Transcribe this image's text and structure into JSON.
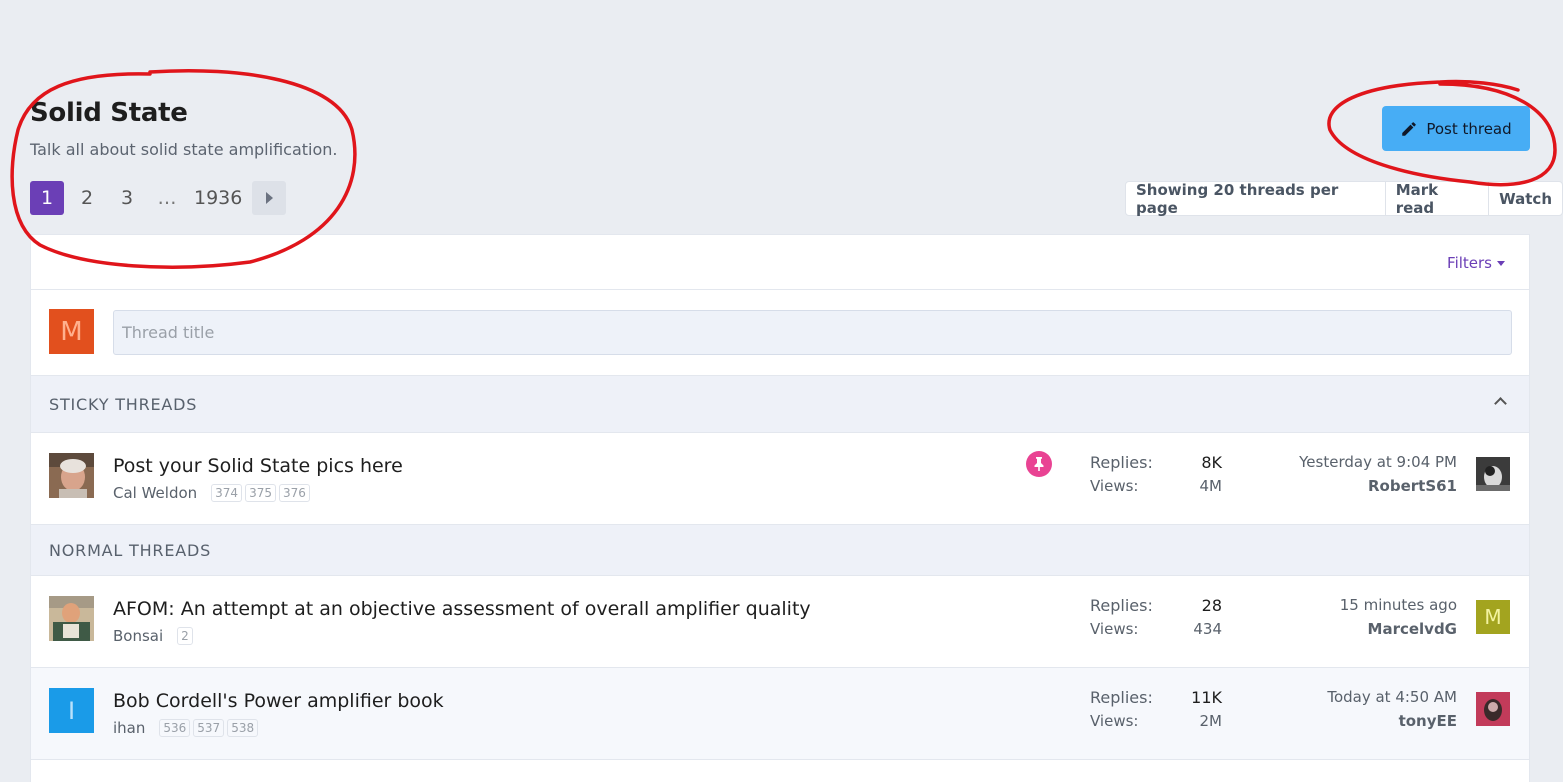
{
  "forum": {
    "title": "Solid State",
    "description": "Talk all about solid state amplification."
  },
  "pagination": {
    "pages": [
      "1",
      "2",
      "3",
      "…",
      "1936"
    ],
    "current": "1"
  },
  "post_button": {
    "label": "Post thread",
    "icon": "pencil-icon"
  },
  "actions": [
    "Showing 20 threads per page",
    "Mark read",
    "Watch"
  ],
  "filters_label": "Filters",
  "quick_thread": {
    "avatar_letter": "M",
    "placeholder": "Thread title"
  },
  "sections": {
    "sticky": "STICKY THREADS",
    "normal": "NORMAL THREADS"
  },
  "sticky_threads": [
    {
      "title": "Post your Solid State pics here",
      "author": "Cal Weldon",
      "pages": [
        "374",
        "375",
        "376"
      ],
      "replies_label": "Replies:",
      "replies": "8K",
      "views_label": "Views:",
      "views": "4M",
      "last_time": "Yesterday at 9:04 PM",
      "last_user": "RobertS61",
      "pinned": true
    }
  ],
  "normal_threads": [
    {
      "title": "AFOM: An attempt at an objective assessment of overall amplifier quality",
      "author": "Bonsai",
      "pages": [
        "2"
      ],
      "replies_label": "Replies:",
      "replies": "28",
      "views_label": "Views:",
      "views": "434",
      "last_time": "15 minutes ago",
      "last_user": "MarcelvdG",
      "last_avatar_letter": "M"
    },
    {
      "title": "Bob Cordell's Power amplifier book",
      "author": "ihan",
      "avatar_letter": "I",
      "pages": [
        "536",
        "537",
        "538"
      ],
      "replies_label": "Replies:",
      "replies": "11K",
      "views_label": "Views:",
      "views": "2M",
      "last_time": "Today at 4:50 AM",
      "last_user": "tonyEE"
    }
  ],
  "colors": {
    "accent": "#6b3fb6",
    "post_button": "#47adf5",
    "annotation": "#e0151b",
    "pin": "#e94393"
  }
}
